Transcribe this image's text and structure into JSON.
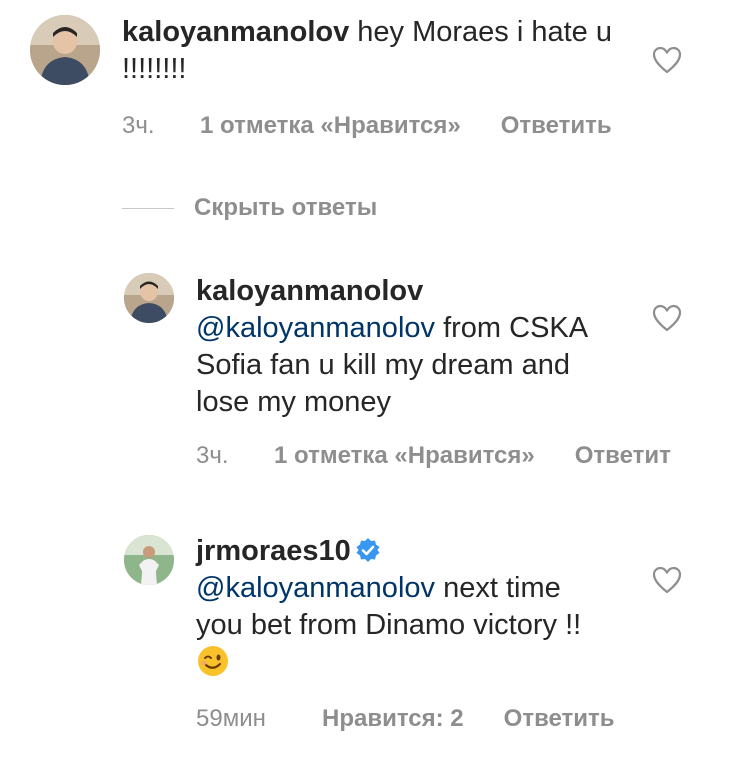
{
  "comments": [
    {
      "username": "kaloyanmanolov",
      "text": "hey Moraes i hate u !!!!!!!!",
      "time": "3ч.",
      "likes": "1 отметка «Нравится»",
      "reply": "Ответить",
      "avatar_icon": "user-avatar",
      "like_icon": "heart-outline-icon"
    },
    {
      "username": "kaloyanmanolov",
      "mention": "@kaloyanmanolov",
      "text": "from CSKA Sofia fan u kill my dream and lose my money",
      "time": "3ч.",
      "likes": "1 отметка «Нравится»",
      "reply": "Ответит",
      "avatar_icon": "user-avatar",
      "like_icon": "heart-outline-icon"
    },
    {
      "username": "jrmoraes10",
      "mention": "@kaloyanmanolov",
      "text": "next time you bet from Dinamo victory !!",
      "time": "59мин",
      "likes": "Нравится: 2",
      "reply": "Ответить",
      "avatar_icon": "user-avatar",
      "verified_icon": "verified-badge-icon",
      "emoji_icon": "winking-face-emoji",
      "like_icon": "heart-outline-icon"
    }
  ],
  "hide_replies": "Скрыть ответы",
  "colors": {
    "text": "#262626",
    "secondary": "#8e8e8e",
    "mention": "#003569",
    "verified": "#3897f0"
  }
}
